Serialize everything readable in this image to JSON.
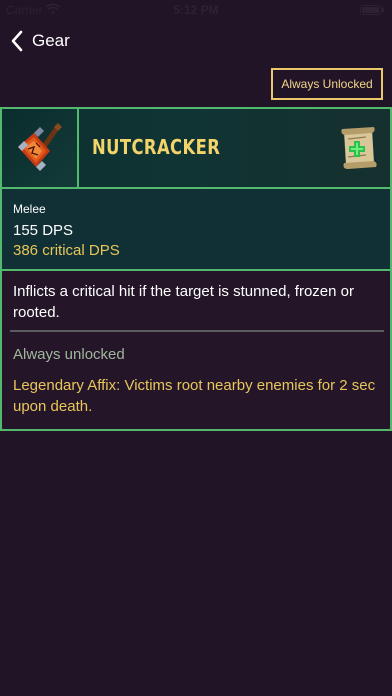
{
  "status_bar": {
    "carrier": "Carrier",
    "time": "5:12 PM"
  },
  "nav": {
    "back_label": "Gear"
  },
  "unlock_button": {
    "label": "Always Unlocked"
  },
  "item": {
    "name": "NUTCRACKER",
    "icon": "cracked-hammer-icon",
    "type_icon": "scroll-icon",
    "weapon_type": "Melee",
    "dps": "155 DPS",
    "critical_dps": "386 critical DPS",
    "description": "Inflicts a critical hit if the target is stunned, frozen or rooted.",
    "unlock_status": "Always unlocked",
    "affix": "Legendary Affix: Victims root nearby enemies for 2 sec upon death."
  },
  "colors": {
    "background": "#211426",
    "card_border": "#53b96c",
    "gold_text": "#e8c65a",
    "muted_green_text": "#9fb89b"
  }
}
